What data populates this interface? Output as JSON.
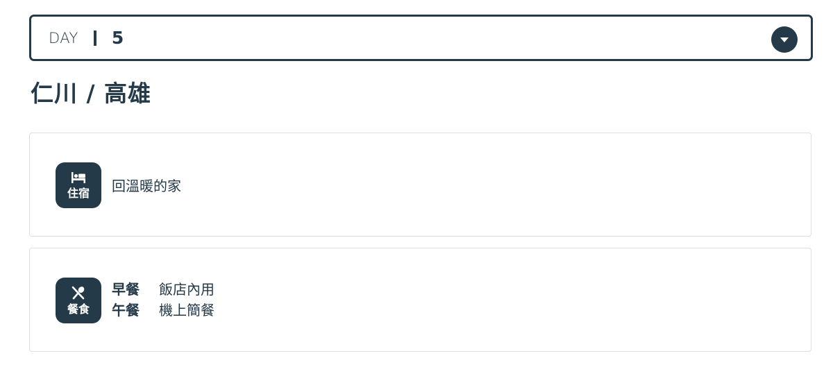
{
  "day_selector": {
    "label": "DAY",
    "value": "5",
    "icon": "chevron-down-icon"
  },
  "route": {
    "title": "仁川 / 高雄"
  },
  "accommodation": {
    "badge_label": "住宿",
    "icon": "bed-icon",
    "text": "回溫暖的家"
  },
  "meals": {
    "badge_label": "餐食",
    "icon": "utensils-icon",
    "items": [
      {
        "label": "早餐",
        "value": "飯店內用"
      },
      {
        "label": "午餐",
        "value": "機上簡餐"
      }
    ]
  },
  "colors": {
    "primary": "#243a48",
    "card_border": "#dcdfe1",
    "background": "#ffffff"
  }
}
